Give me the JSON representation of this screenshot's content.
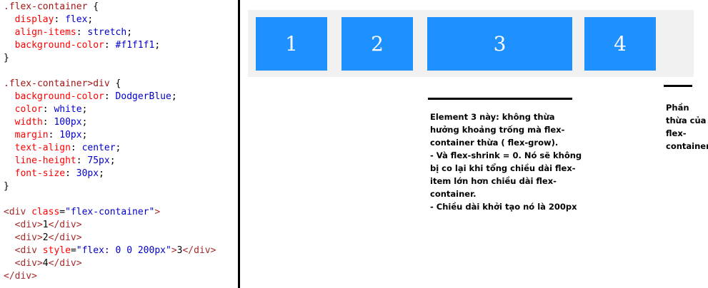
{
  "code": {
    "lines": [
      [
        {
          "t": ".flex-container",
          "c": "sel"
        },
        {
          "t": " {",
          "c": "pun"
        }
      ],
      [
        {
          "t": "  display",
          "c": "prop"
        },
        {
          "t": ": ",
          "c": "pun"
        },
        {
          "t": "flex",
          "c": "val"
        },
        {
          "t": ";",
          "c": "pun"
        }
      ],
      [
        {
          "t": "  align-items",
          "c": "prop"
        },
        {
          "t": ": ",
          "c": "pun"
        },
        {
          "t": "stretch",
          "c": "val"
        },
        {
          "t": ";",
          "c": "pun"
        }
      ],
      [
        {
          "t": "  background-color",
          "c": "prop"
        },
        {
          "t": ": ",
          "c": "pun"
        },
        {
          "t": "#f1f1f1",
          "c": "val"
        },
        {
          "t": ";",
          "c": "pun"
        }
      ],
      [
        {
          "t": "}",
          "c": "pun"
        }
      ],
      [],
      [
        {
          "t": ".flex-container>div",
          "c": "sel"
        },
        {
          "t": " {",
          "c": "pun"
        }
      ],
      [
        {
          "t": "  background-color",
          "c": "prop"
        },
        {
          "t": ": ",
          "c": "pun"
        },
        {
          "t": "DodgerBlue",
          "c": "val"
        },
        {
          "t": ";",
          "c": "pun"
        }
      ],
      [
        {
          "t": "  color",
          "c": "prop"
        },
        {
          "t": ": ",
          "c": "pun"
        },
        {
          "t": "white",
          "c": "val"
        },
        {
          "t": ";",
          "c": "pun"
        }
      ],
      [
        {
          "t": "  width",
          "c": "prop"
        },
        {
          "t": ": ",
          "c": "pun"
        },
        {
          "t": "100px",
          "c": "val"
        },
        {
          "t": ";",
          "c": "pun"
        }
      ],
      [
        {
          "t": "  margin",
          "c": "prop"
        },
        {
          "t": ": ",
          "c": "pun"
        },
        {
          "t": "10px",
          "c": "val"
        },
        {
          "t": ";",
          "c": "pun"
        }
      ],
      [
        {
          "t": "  text-align",
          "c": "prop"
        },
        {
          "t": ": ",
          "c": "pun"
        },
        {
          "t": "center",
          "c": "val"
        },
        {
          "t": ";",
          "c": "pun"
        }
      ],
      [
        {
          "t": "  line-height",
          "c": "prop"
        },
        {
          "t": ": ",
          "c": "pun"
        },
        {
          "t": "75px",
          "c": "val"
        },
        {
          "t": ";",
          "c": "pun"
        }
      ],
      [
        {
          "t": "  font-size",
          "c": "prop"
        },
        {
          "t": ": ",
          "c": "pun"
        },
        {
          "t": "30px",
          "c": "val"
        },
        {
          "t": ";",
          "c": "pun"
        }
      ],
      [
        {
          "t": "}",
          "c": "pun"
        }
      ],
      [],
      [
        {
          "t": "<div",
          "c": "tag"
        },
        {
          "t": " class",
          "c": "attr"
        },
        {
          "t": "=",
          "c": "pun"
        },
        {
          "t": "\"flex-container\"",
          "c": "str"
        },
        {
          "t": ">",
          "c": "tag"
        }
      ],
      [
        {
          "t": "  <div>",
          "c": "tag"
        },
        {
          "t": "1",
          "c": "pun"
        },
        {
          "t": "</div>",
          "c": "tag"
        }
      ],
      [
        {
          "t": "  <div>",
          "c": "tag"
        },
        {
          "t": "2",
          "c": "pun"
        },
        {
          "t": "</div>",
          "c": "tag"
        }
      ],
      [
        {
          "t": "  <div",
          "c": "tag"
        },
        {
          "t": " style",
          "c": "attr"
        },
        {
          "t": "=",
          "c": "pun"
        },
        {
          "t": "\"flex: 0 0 200px\"",
          "c": "str"
        },
        {
          "t": ">",
          "c": "tag"
        },
        {
          "t": "3",
          "c": "pun"
        },
        {
          "t": "</div>",
          "c": "tag"
        }
      ],
      [
        {
          "t": "  <div>",
          "c": "tag"
        },
        {
          "t": "4",
          "c": "pun"
        },
        {
          "t": "</div>",
          "c": "tag"
        }
      ],
      [
        {
          "t": "</div>",
          "c": "tag"
        }
      ]
    ]
  },
  "colors": {
    "selector": "#a31515",
    "property": "#ff0000",
    "value": "#0000cd",
    "tag": "#a52a2a",
    "box": "#1e90ff",
    "container": "#f1f1f1"
  },
  "demo": {
    "items": [
      "1",
      "2",
      "3",
      "4"
    ]
  },
  "notes": {
    "element3": [
      "Element 3 này: không thừa",
      "hưởng khoảng trống mà flex-",
      "container thừa ( flex-grow).",
      "- Và flex-shrink = 0. Nó sẽ không",
      "bị co lại khi tổng chiều dài flex-",
      "item lớn hơn chiều dài flex-",
      "container.",
      "- Chiều dài khởi tạo nó là 200px"
    ],
    "remaining": [
      "Phần",
      "thừa của",
      "flex-",
      "container"
    ]
  }
}
